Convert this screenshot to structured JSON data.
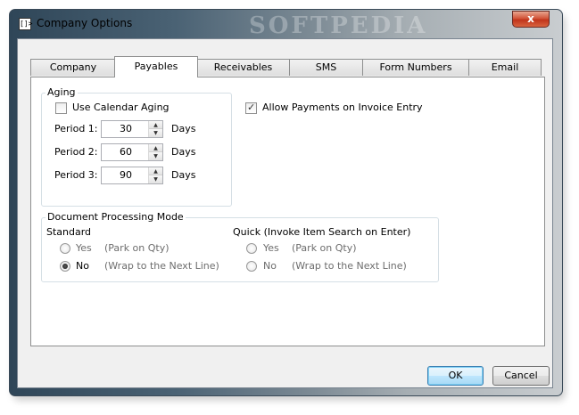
{
  "window": {
    "title": "Company Options",
    "app_icon_glyph": "[]>",
    "watermark": "SOFTPEDIA",
    "close_glyph": "x"
  },
  "tabs": [
    {
      "label": "Company",
      "active": false
    },
    {
      "label": "Payables",
      "active": true
    },
    {
      "label": "Receivables",
      "active": false
    },
    {
      "label": "SMS",
      "active": false
    },
    {
      "label": "Form Numbers",
      "active": false
    },
    {
      "label": "Email",
      "active": false
    }
  ],
  "aging": {
    "legend": "Aging",
    "use_calendar_label": "Use Calendar Aging",
    "use_calendar_checked": false,
    "periods": [
      {
        "label": "Period 1:",
        "value": "30",
        "unit": "Days"
      },
      {
        "label": "Period 2:",
        "value": "60",
        "unit": "Days"
      },
      {
        "label": "Period 3:",
        "value": "90",
        "unit": "Days"
      }
    ]
  },
  "allow_payments": {
    "label": "Allow Payments on Invoice Entry",
    "checked": true
  },
  "doc_mode": {
    "legend": "Document Processing Mode",
    "standard": {
      "heading": "Standard",
      "options": [
        {
          "label": "Yes",
          "hint": "(Park on Qty)",
          "selected": false
        },
        {
          "label": "No",
          "hint": "(Wrap to the Next Line)",
          "selected": true
        }
      ]
    },
    "quick": {
      "heading": "Quick  (Invoke Item Search on Enter)",
      "options": [
        {
          "label": "Yes",
          "hint": "(Park on Qty)",
          "selected": false
        },
        {
          "label": "No",
          "hint": "(Wrap to the Next Line)",
          "selected": false
        }
      ]
    }
  },
  "buttons": {
    "ok": "OK",
    "cancel": "Cancel"
  },
  "icons": {
    "up": "▲",
    "down": "▼"
  }
}
